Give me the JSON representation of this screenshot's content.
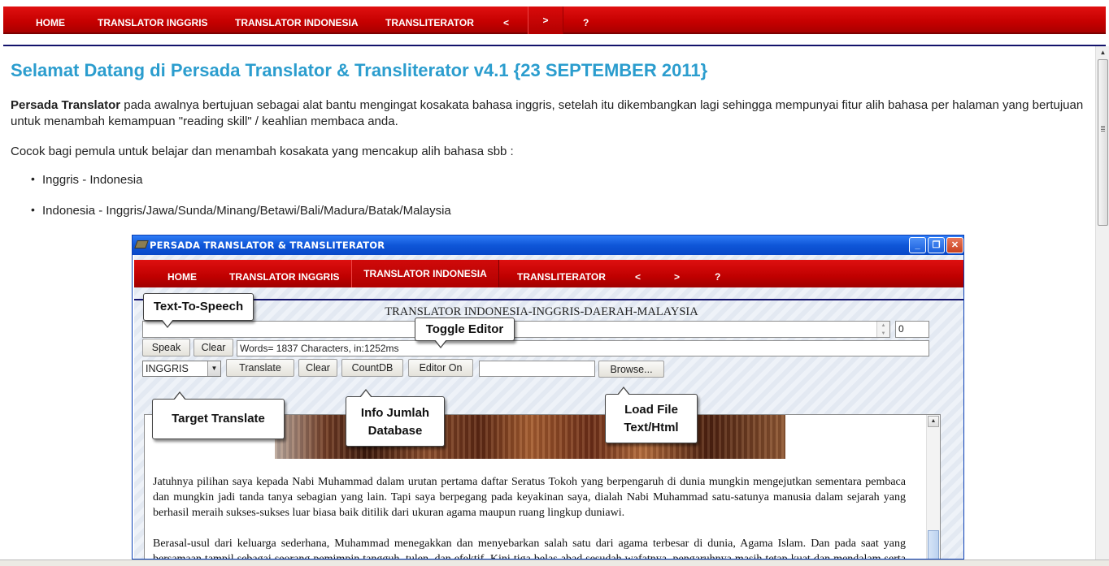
{
  "nav": {
    "items": [
      "HOME",
      "TRANSLATOR INGGRIS",
      "TRANSLATOR INDONESIA",
      "TRANSLITERATOR",
      "<",
      ">",
      "?"
    ]
  },
  "page": {
    "title": "Selamat Datang di Persada Translator & Transliterator v4.1 {23 SEPTEMBER 2011}",
    "intro_bold": "Persada Translator",
    "intro_rest": " pada awalnya bertujuan sebagai alat bantu mengingat kosakata bahasa inggris,  setelah itu dikembangkan lagi sehingga mempunyai fitur alih bahasa per halaman yang bertujuan untuk menambah kemampuan \"reading skill\" / keahlian membaca anda.",
    "subtitle": "Cocok bagi pemula untuk belajar dan menambah kosakata yang mencakup alih bahasa sbb :",
    "bullets": [
      "Inggris - Indonesia",
      "Indonesia - Inggris/Jawa/Sunda/Minang/Betawi/Bali/Madura/Batak/Malaysia"
    ]
  },
  "app": {
    "window_title": "PERSADA TRANSLATOR & TRANSLITERATOR",
    "nav": [
      "HOME",
      "TRANSLATOR INGGRIS",
      "TRANSLATOR INDONESIA",
      "TRANSLITERATOR",
      "<",
      ">",
      "?"
    ],
    "heading": "TRANSLATOR INDONESIA-INGGRIS-DAERAH-MALAYSIA",
    "counter_value": "0",
    "speak_label": "Speak",
    "clear_label": "Clear",
    "status_text": "Words= 1837 Characters, in:1252ms",
    "target_select": "INGGRIS",
    "translate_label": "Translate",
    "clear2_label": "Clear",
    "countdb_label": "CountDB",
    "editor_label": "Editor On",
    "browse_label": "Browse...",
    "file_value": "",
    "paragraph1": "Jatuhnya pilihan saya kepada Nabi Muhammad dalam urutan pertama daftar Seratus Tokoh yang berpengaruh di dunia mungkin mengejutkan sementara pembaca dan mungkin jadi tanda tanya sebagian yang lain. Tapi saya berpegang pada keyakinan saya, dialah Nabi Muhammad satu-satunya manusia dalam sejarah yang berhasil meraih sukses-sukses luar biasa baik ditilik dari ukuran agama maupun ruang lingkup duniawi.",
    "paragraph2": "Berasal-usul dari keluarga sederhana, Muhammad menegakkan dan menyebarkan salah satu dari agama terbesar di dunia, Agama Islam. Dan pada saat yang bersamaan tampil sebagai seorang pemimpin tangguh, tulen, dan efektif. Kini tiga belas abad sesudah wafatnya, pengaruhnya masih tetap kuat dan mendalam serta berakar."
  },
  "callouts": {
    "tts": "Text-To-Speech",
    "toggle": "Toggle Editor",
    "target": "Target Translate",
    "info1": "Info Jumlah",
    "info2": "Database",
    "load1": "Load File",
    "load2": "Text/Html"
  },
  "colors": {
    "nav_red": "#c50000",
    "title_blue": "#2b9dce",
    "nav_line": "#12126b"
  }
}
